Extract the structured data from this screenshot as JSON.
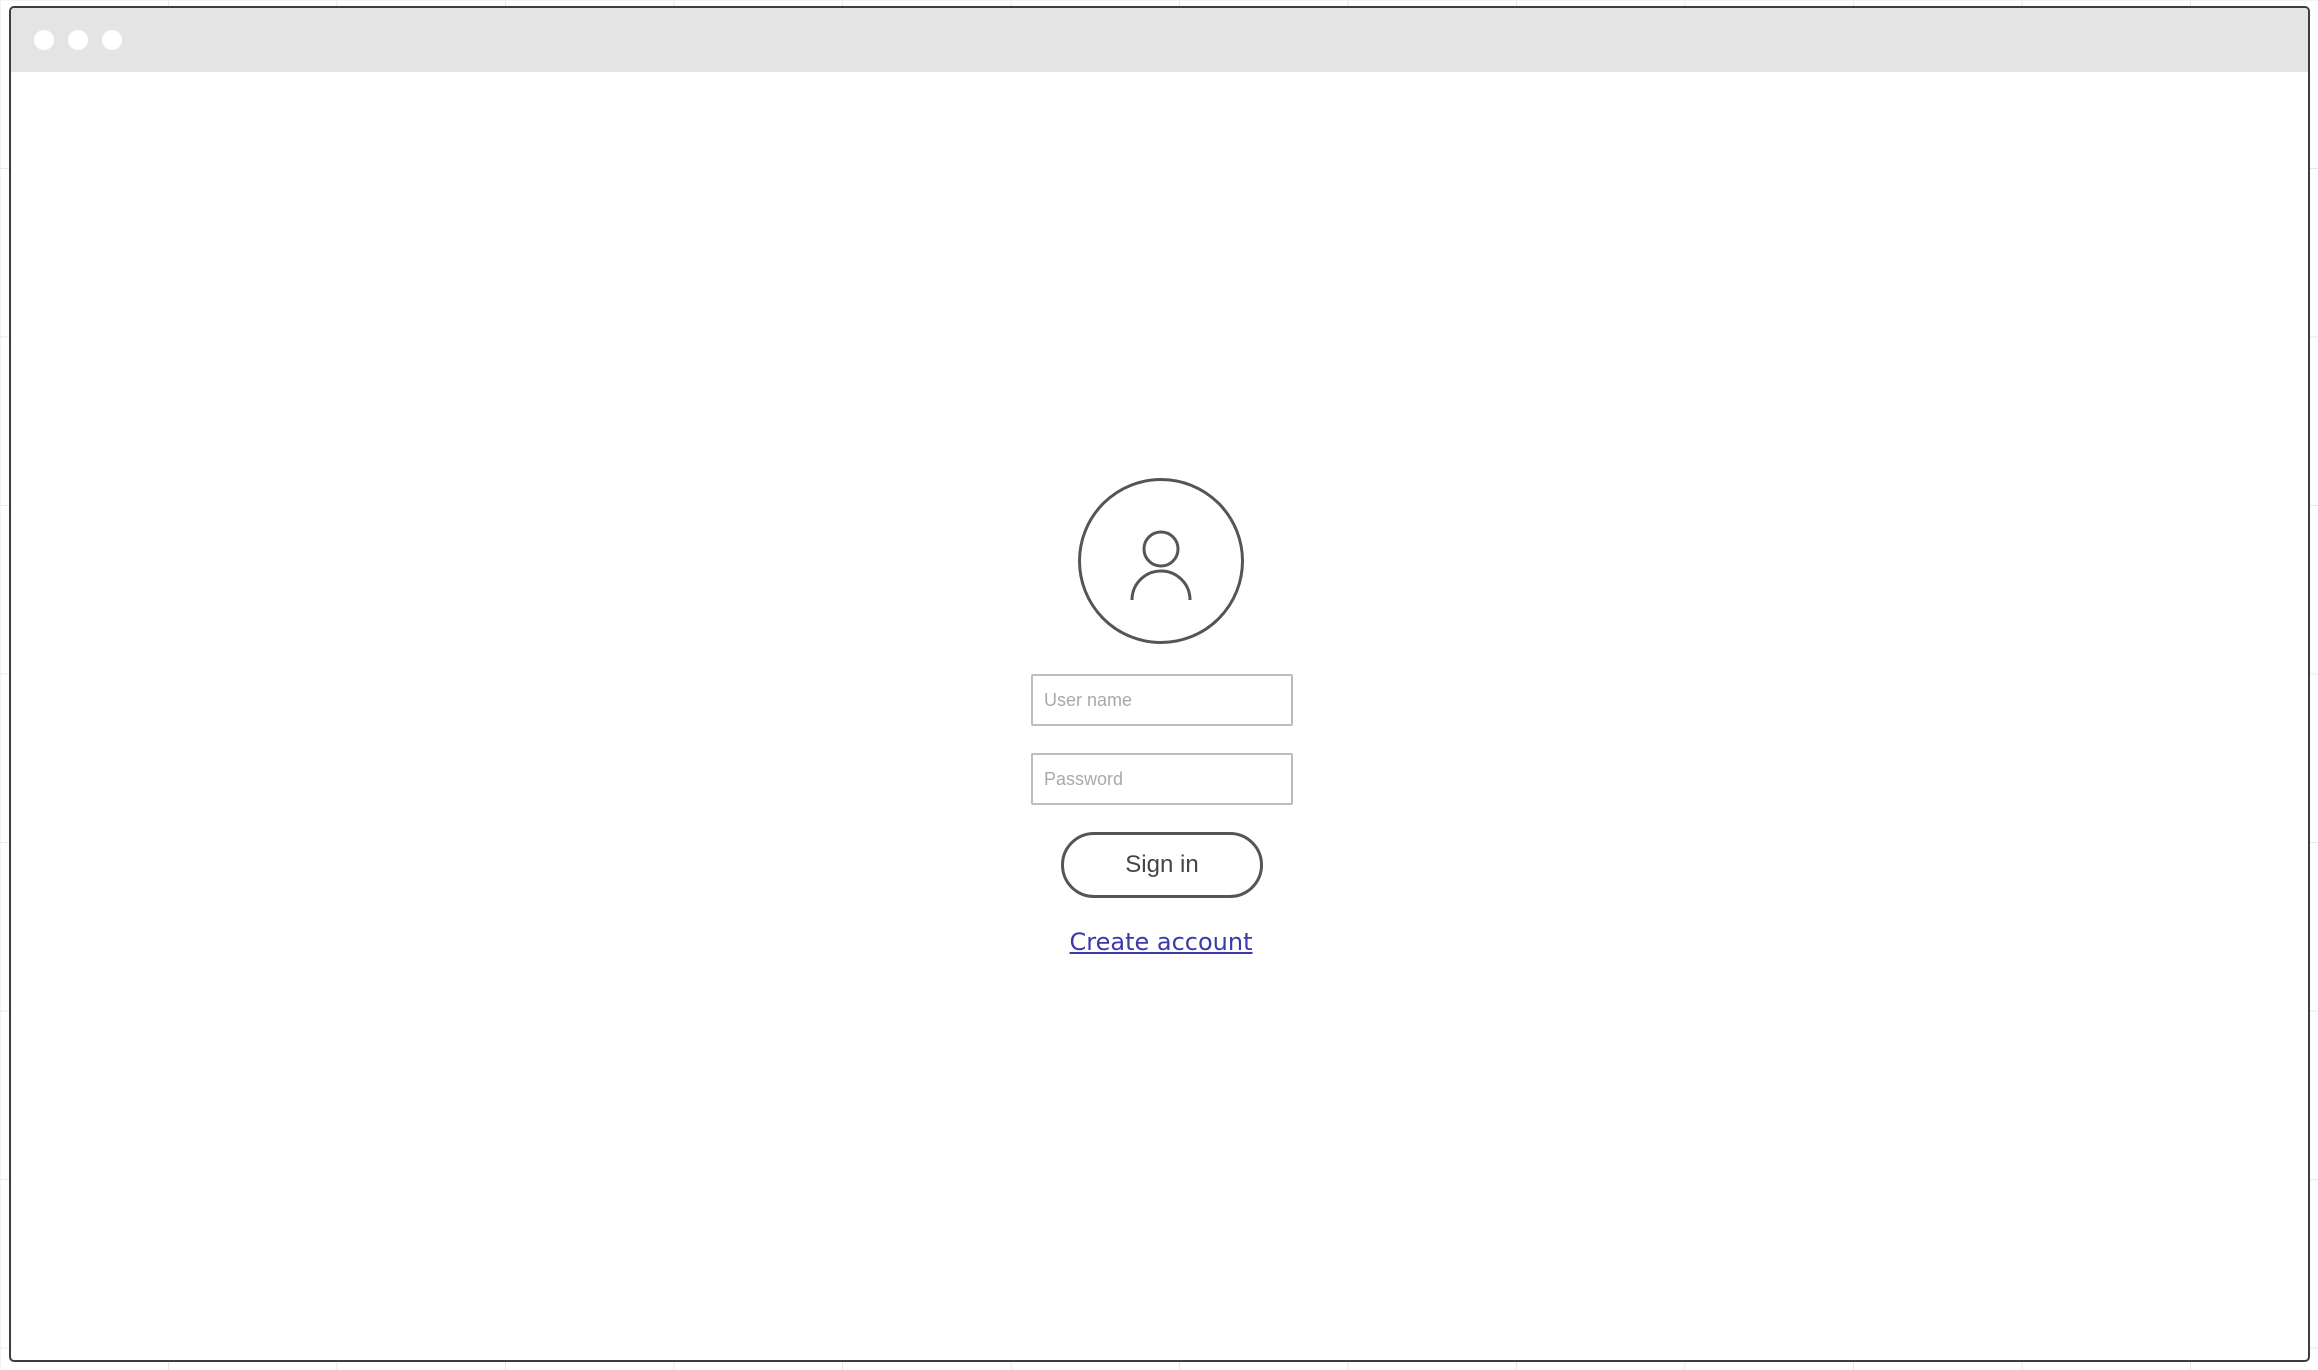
{
  "window": {
    "controls": [
      "close-dot",
      "minimize-dot",
      "maximize-dot"
    ]
  },
  "login": {
    "avatar_icon": "user-icon",
    "username": {
      "value": "",
      "placeholder": "User name"
    },
    "password": {
      "value": "",
      "placeholder": "Password"
    },
    "signin_label": "Sign in",
    "create_account_label": "Create account"
  },
  "colors": {
    "link": "#3a3aa8",
    "stroke": "#555555",
    "titlebar": "#e4e4e4"
  }
}
